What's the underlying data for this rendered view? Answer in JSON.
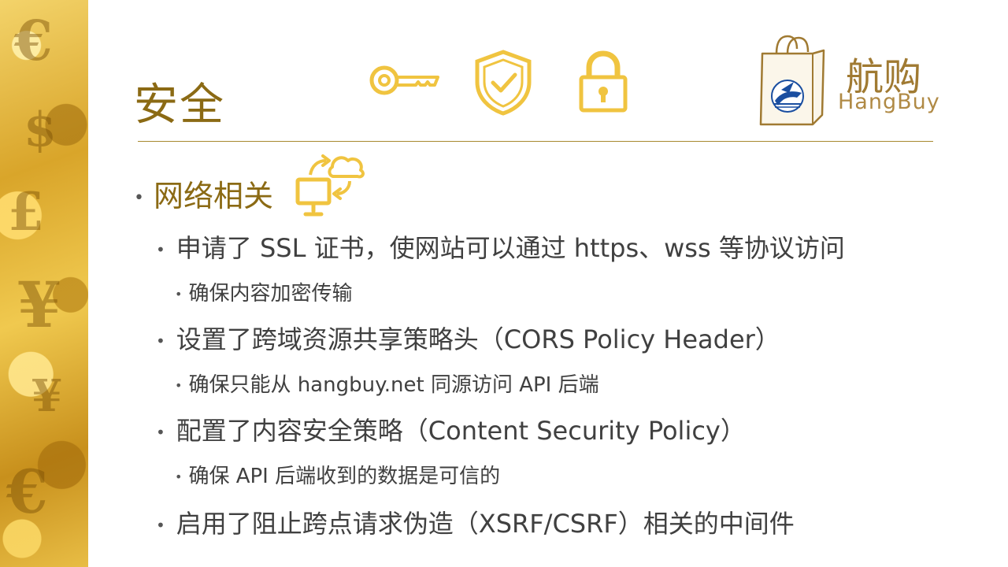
{
  "slide": {
    "title": "安全",
    "brand": {
      "name": "航购",
      "en": "HangBuy"
    },
    "icons": [
      "key-icon",
      "shield-check-icon",
      "padlock-icon",
      "shopping-bag-logo-icon",
      "network-sync-icon"
    ],
    "accent_color": "#8b6a14",
    "icon_color": "#f0c440",
    "section": "网络相关",
    "items": [
      {
        "text": "申请了 SSL 证书，使网站可以通过 https、wss 等协议访问",
        "sub": "确保内容加密传输"
      },
      {
        "text": "设置了跨域资源共享策略头（CORS Policy Header）",
        "sub": "确保只能从 hangbuy.net 同源访问 API 后端"
      },
      {
        "text": "配置了内容安全策略（Content Security Policy）",
        "sub": "确保 API 后端收到的数据是可信的"
      },
      {
        "text": "启用了阻止跨点请求伪造（XSRF/CSRF）相关的中间件",
        "sub": ""
      }
    ]
  }
}
